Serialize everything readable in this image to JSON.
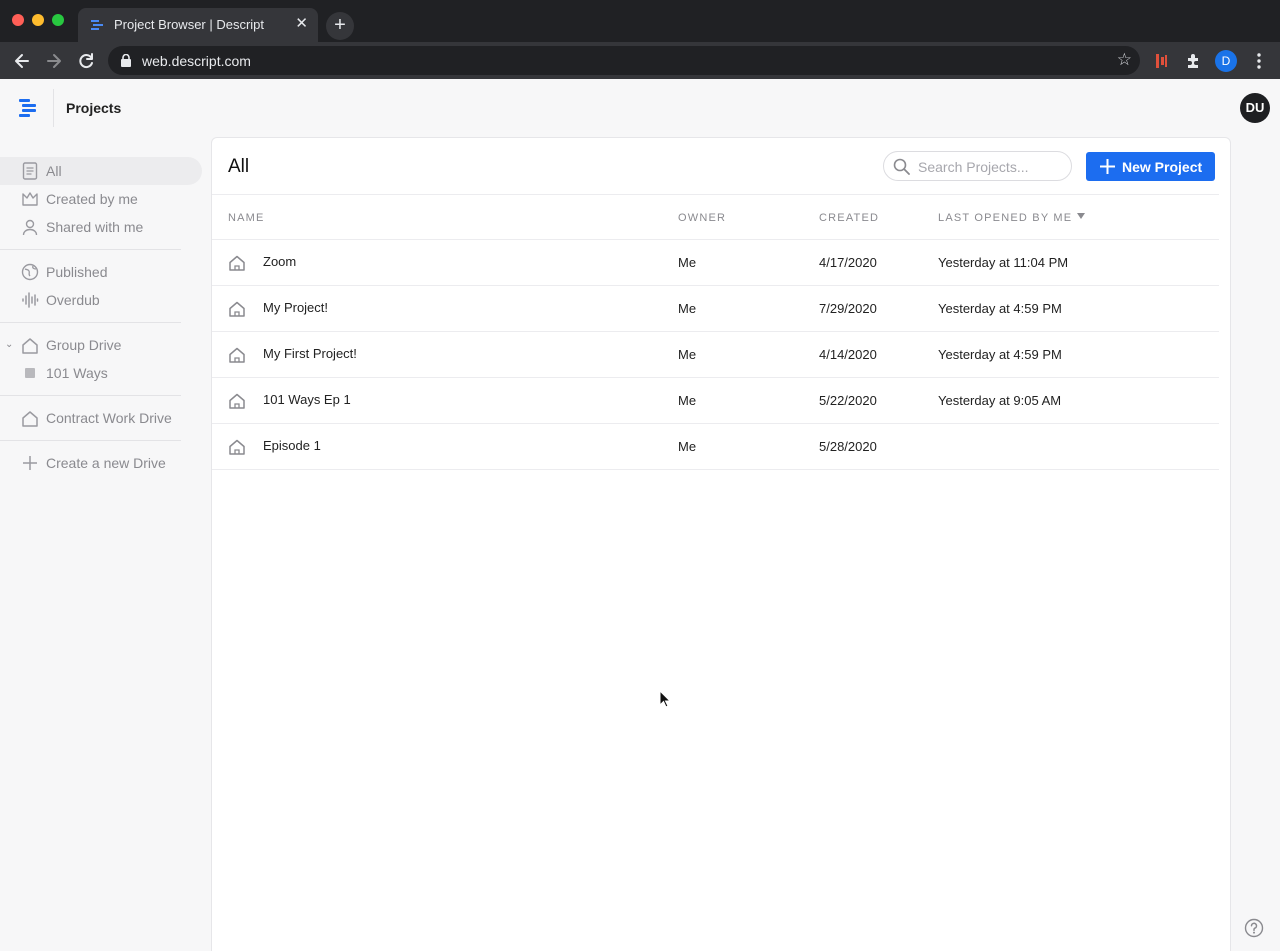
{
  "browser": {
    "tab_title": "Project Browser | Descript",
    "tab_close": "✕",
    "new_tab": "+",
    "url": "web.descript.com",
    "profile_initial": "D"
  },
  "header": {
    "title": "Projects",
    "avatar_initials": "DU"
  },
  "sidebar": {
    "items": [
      {
        "label": "All",
        "icon": "document-icon",
        "active": true
      },
      {
        "label": "Created by me",
        "icon": "crown-icon"
      },
      {
        "label": "Shared with me",
        "icon": "person-icon"
      },
      {
        "label": "Published",
        "icon": "globe-icon"
      },
      {
        "label": "Overdub",
        "icon": "waveform-icon"
      },
      {
        "label": "Group Drive",
        "icon": "home-icon",
        "expanded": true
      },
      {
        "label": "101 Ways",
        "icon": "square-icon"
      },
      {
        "label": "Contract Work Drive",
        "icon": "home-icon"
      },
      {
        "label": "Create a new Drive",
        "icon": "plus-icon"
      }
    ]
  },
  "main": {
    "title": "All",
    "search_placeholder": "Search Projects...",
    "new_project_label": "New Project",
    "columns": {
      "name": "NAME",
      "owner": "OWNER",
      "created": "CREATED",
      "last_opened": "LAST OPENED BY ME"
    },
    "rows": [
      {
        "name": "Zoom",
        "owner": "Me",
        "created": "4/17/2020",
        "last_opened": "Yesterday at 11:04 PM"
      },
      {
        "name": "My Project!",
        "owner": "Me",
        "created": "7/29/2020",
        "last_opened": "Yesterday at 4:59 PM"
      },
      {
        "name": "My First Project!",
        "owner": "Me",
        "created": "4/14/2020",
        "last_opened": "Yesterday at 4:59 PM"
      },
      {
        "name": "101 Ways Ep 1",
        "owner": "Me",
        "created": "5/22/2020",
        "last_opened": "Yesterday at 9:05 AM"
      },
      {
        "name": "Episode 1",
        "owner": "Me",
        "created": "5/28/2020",
        "last_opened": ""
      }
    ]
  },
  "colors": {
    "accent": "#1c6df0",
    "chrome_dark": "#202124",
    "chrome_mid": "#35363a",
    "avatar_bg": "#1e1f22",
    "sidebar_text": "#8a8a8f"
  }
}
